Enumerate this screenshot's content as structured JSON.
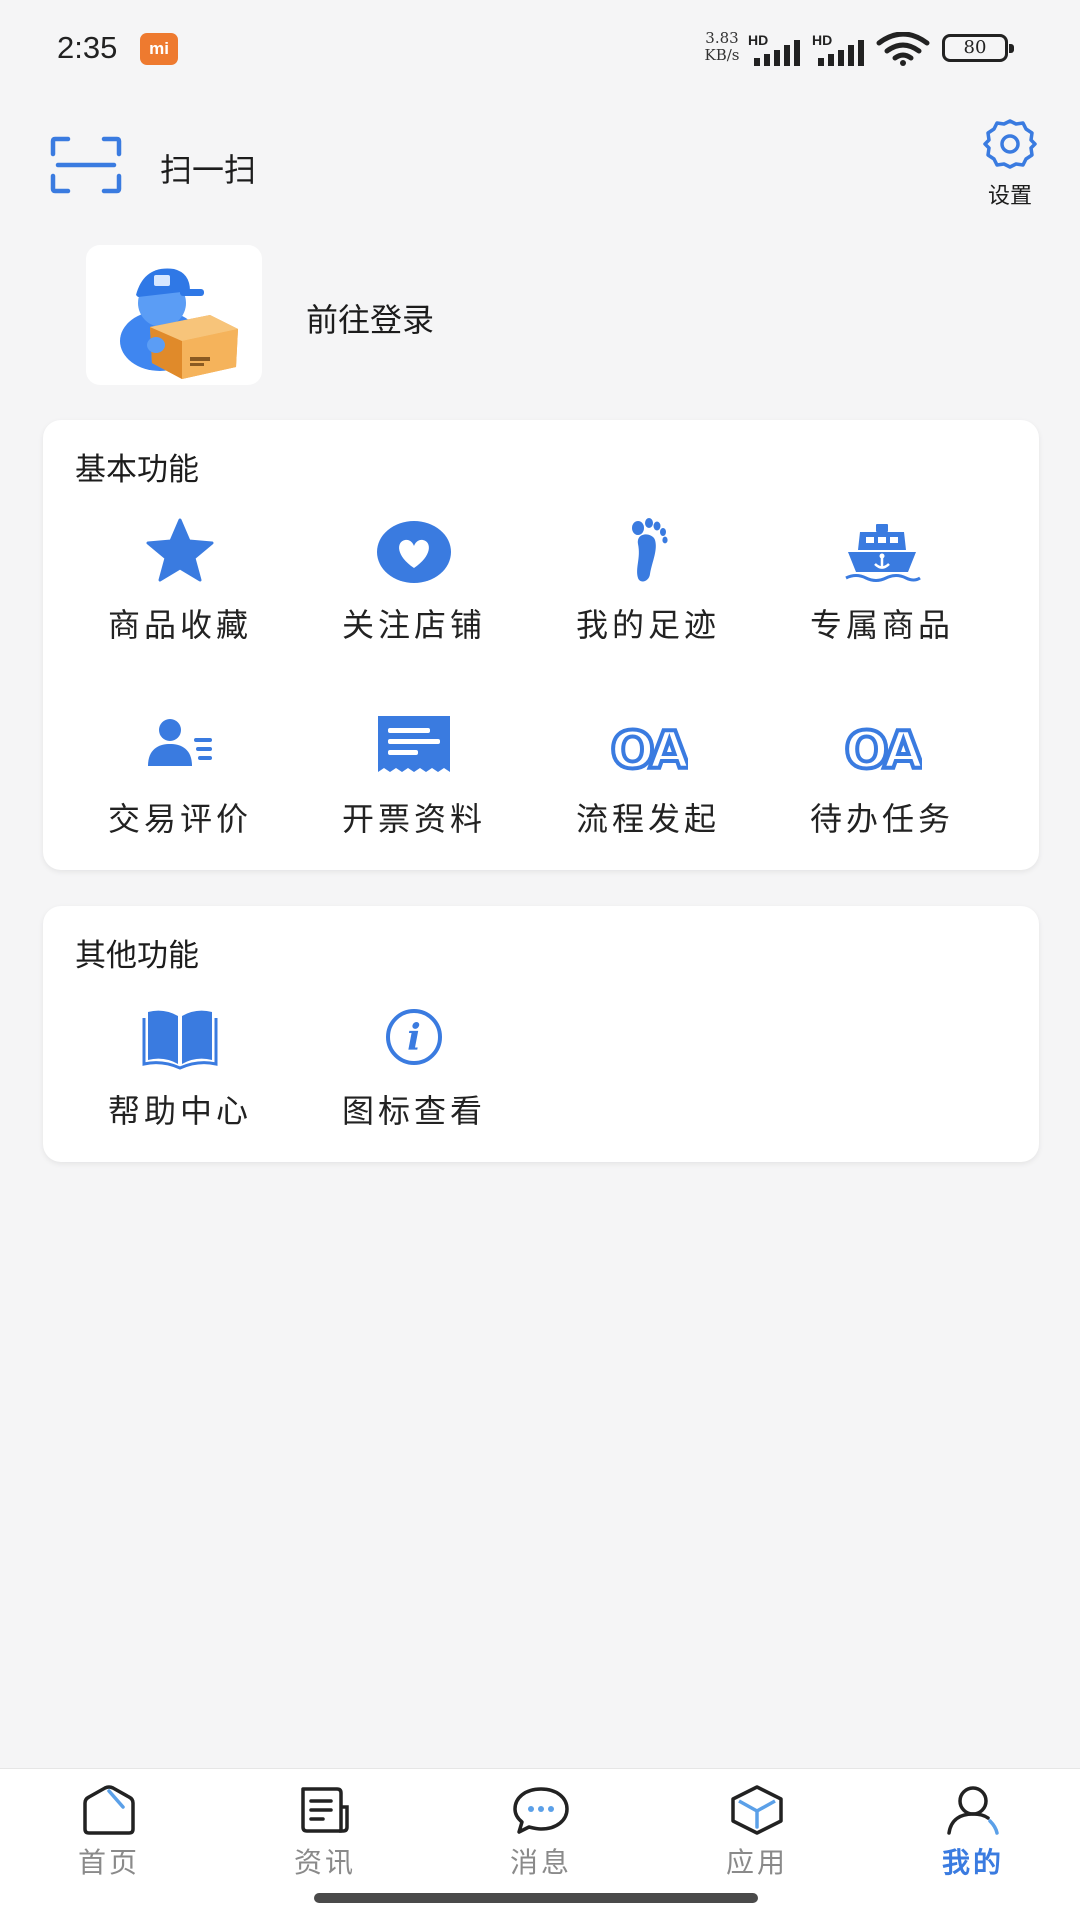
{
  "status_bar": {
    "time": "2:35",
    "badge": "mi",
    "net_speed_value": "3.83",
    "net_speed_unit": "KB/s",
    "sim1_label": "HD",
    "sim2_label": "HD",
    "battery_level": "80"
  },
  "header": {
    "scan_label": "扫一扫",
    "settings_label": "设置"
  },
  "profile": {
    "login_label": "前往登录"
  },
  "basic_features": {
    "title": "基本功能",
    "items": [
      {
        "label": "商品收藏",
        "icon": "star-icon"
      },
      {
        "label": "关注店铺",
        "icon": "heart-icon"
      },
      {
        "label": "我的足迹",
        "icon": "footprint-icon"
      },
      {
        "label": "专属商品",
        "icon": "ship-anchor-icon"
      },
      {
        "label": "交易评价",
        "icon": "user-review-icon"
      },
      {
        "label": "开票资料",
        "icon": "receipt-icon"
      },
      {
        "label": "流程发起",
        "icon": "oa-icon",
        "icon_text": "OA"
      },
      {
        "label": "待办任务",
        "icon": "oa-icon",
        "icon_text": "OA"
      }
    ]
  },
  "other_features": {
    "title": "其他功能",
    "items": [
      {
        "label": "帮助中心",
        "icon": "book-icon"
      },
      {
        "label": "图标查看",
        "icon": "info-icon",
        "icon_text": "i"
      }
    ]
  },
  "bottom_nav": {
    "items": [
      {
        "label": "首页",
        "icon": "home-icon"
      },
      {
        "label": "资讯",
        "icon": "news-icon"
      },
      {
        "label": "消息",
        "icon": "message-icon"
      },
      {
        "label": "应用",
        "icon": "box-icon"
      },
      {
        "label": "我的",
        "icon": "person-icon"
      }
    ],
    "active_index": 4
  },
  "colors": {
    "accent": "#3a7be0",
    "background": "#f5f5f6",
    "inactive_nav": "#8a8a8a",
    "mi_badge": "#ee7a2f"
  }
}
